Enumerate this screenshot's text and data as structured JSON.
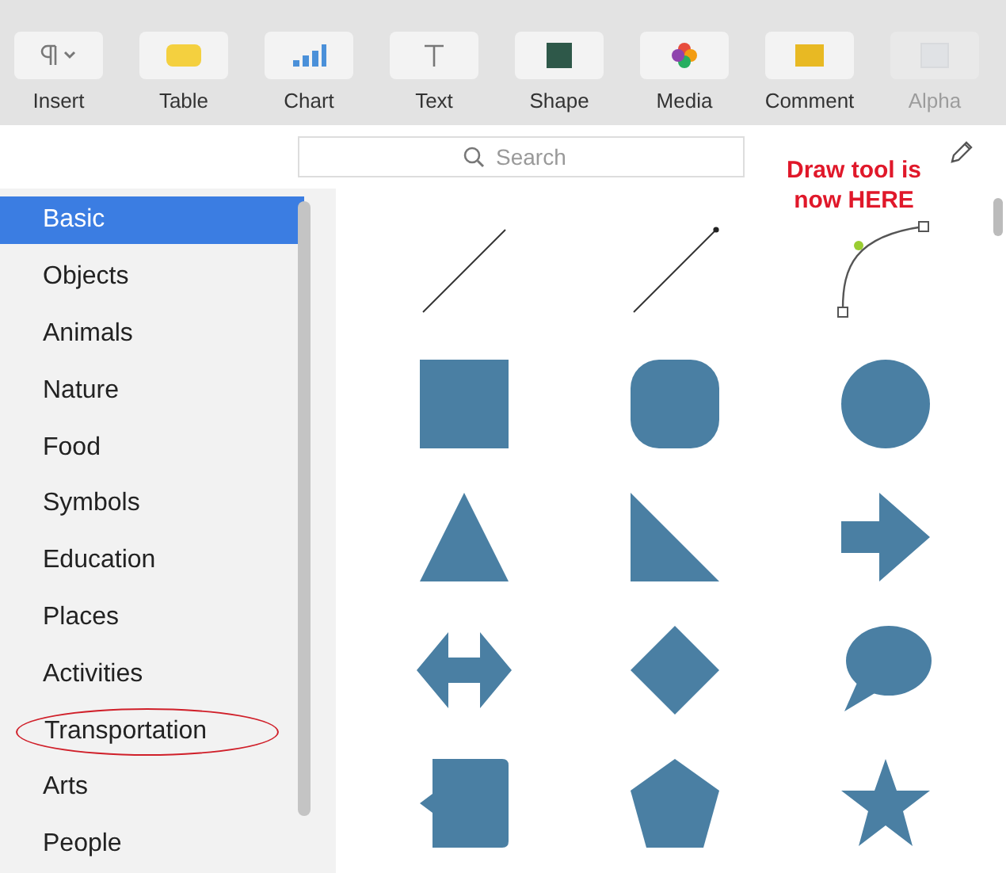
{
  "toolbar": {
    "items": [
      {
        "label": "Insert",
        "kind": "paragraph",
        "disabled": false
      },
      {
        "label": "Table",
        "kind": "table",
        "disabled": false
      },
      {
        "label": "Chart",
        "kind": "chart",
        "disabled": false
      },
      {
        "label": "Text",
        "kind": "text",
        "disabled": false
      },
      {
        "label": "Shape",
        "kind": "shape",
        "disabled": false
      },
      {
        "label": "Media",
        "kind": "media",
        "disabled": false
      },
      {
        "label": "Comment",
        "kind": "comment",
        "disabled": false
      },
      {
        "label": "Alpha",
        "kind": "alpha",
        "disabled": true
      }
    ]
  },
  "search": {
    "placeholder": "Search"
  },
  "annotation": {
    "text": "Draw tool is now HERE"
  },
  "sidebar": {
    "items": [
      {
        "label": "Basic",
        "selected": true,
        "circled": false
      },
      {
        "label": "Objects",
        "selected": false,
        "circled": false
      },
      {
        "label": "Animals",
        "selected": false,
        "circled": false
      },
      {
        "label": "Nature",
        "selected": false,
        "circled": false
      },
      {
        "label": "Food",
        "selected": false,
        "circled": false
      },
      {
        "label": "Symbols",
        "selected": false,
        "circled": false
      },
      {
        "label": "Education",
        "selected": false,
        "circled": false
      },
      {
        "label": "Places",
        "selected": false,
        "circled": false
      },
      {
        "label": "Activities",
        "selected": false,
        "circled": false
      },
      {
        "label": "Transportation",
        "selected": false,
        "circled": true
      },
      {
        "label": "Arts",
        "selected": false,
        "circled": false
      },
      {
        "label": "People",
        "selected": false,
        "circled": false
      }
    ]
  },
  "shapes": [
    {
      "kind": "line"
    },
    {
      "kind": "arrow-line"
    },
    {
      "kind": "curve"
    },
    {
      "kind": "square"
    },
    {
      "kind": "rounded-square"
    },
    {
      "kind": "circle"
    },
    {
      "kind": "triangle"
    },
    {
      "kind": "right-triangle"
    },
    {
      "kind": "arrow"
    },
    {
      "kind": "double-arrow"
    },
    {
      "kind": "diamond"
    },
    {
      "kind": "speech-bubble"
    },
    {
      "kind": "callout"
    },
    {
      "kind": "pentagon"
    },
    {
      "kind": "star"
    }
  ]
}
